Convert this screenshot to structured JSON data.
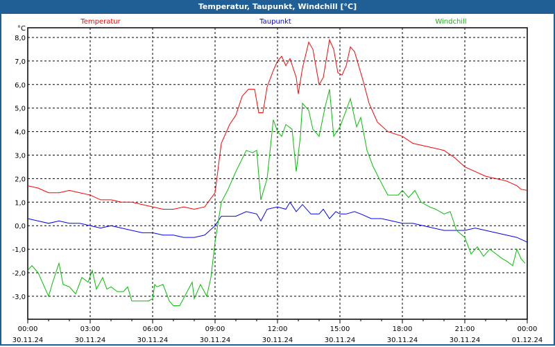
{
  "window": {
    "title": "Temperatur, Taupunkt, Windchill [°C]"
  },
  "chart_data": {
    "type": "line",
    "title": "Temperatur, Taupunkt, Windchill [°C]",
    "ylabel": "°C",
    "ylim": [
      -4.0,
      8.4
    ],
    "xlim": [
      0,
      24
    ],
    "grid": true,
    "legend_placement": "top",
    "yticks": [
      8,
      7,
      6,
      5,
      4,
      3,
      2,
      1,
      0,
      -1,
      -2,
      -3
    ],
    "ytick_labels": [
      "8,0",
      "7,0",
      "6,0",
      "5,0",
      "4,0",
      "3,0",
      "2,0",
      "1,0",
      "0,0",
      "-1,0",
      "-2,0",
      "-3,0"
    ],
    "xticks": [
      0,
      3,
      6,
      9,
      12,
      15,
      18,
      21,
      24
    ],
    "xtick_labels": [
      [
        "00:00",
        "30.11.24"
      ],
      [
        "03:00",
        "30.11.24"
      ],
      [
        "06:00",
        "30.11.24"
      ],
      [
        "09:00",
        "30.11.24"
      ],
      [
        "12:00",
        "30.11.24"
      ],
      [
        "15:00",
        "30.11.24"
      ],
      [
        "18:00",
        "30.11.24"
      ],
      [
        "21:00",
        "30.11.24"
      ],
      [
        "00:00",
        "01.12.24"
      ]
    ],
    "series": [
      {
        "name": "Temperatur",
        "color": "#ff0000",
        "legend": "left",
        "x": [
          0,
          0.5,
          1,
          1.5,
          2,
          2.5,
          3,
          3.5,
          4,
          4.5,
          5,
          5.5,
          6,
          6.5,
          7,
          7.5,
          8,
          8.5,
          9,
          9.3,
          9.7,
          10,
          10.3,
          10.6,
          10.9,
          11.1,
          11.3,
          11.5,
          11.8,
          12,
          12.2,
          12.4,
          12.6,
          12.9,
          13,
          13.2,
          13.5,
          13.7,
          14,
          14.2,
          14.5,
          14.7,
          14.9,
          15.1,
          15.3,
          15.5,
          15.7,
          15.9,
          16.1,
          16.4,
          16.8,
          17.3,
          18,
          18.5,
          19,
          19.5,
          20,
          20.5,
          21,
          21.5,
          22,
          22.5,
          23,
          23.5,
          23.7,
          24
        ],
        "y": [
          1.7,
          1.6,
          1.4,
          1.4,
          1.5,
          1.4,
          1.3,
          1.1,
          1.1,
          1.0,
          1.0,
          0.9,
          0.8,
          0.7,
          0.7,
          0.8,
          0.7,
          0.8,
          1.4,
          3.5,
          4.3,
          4.7,
          5.5,
          5.8,
          5.8,
          4.8,
          4.8,
          5.9,
          6.6,
          7.0,
          7.2,
          6.8,
          7.1,
          6.3,
          5.6,
          6.7,
          7.8,
          7.5,
          6.0,
          6.3,
          7.9,
          7.5,
          6.5,
          6.4,
          6.8,
          7.6,
          7.4,
          6.8,
          6.2,
          5.2,
          4.4,
          4.0,
          3.8,
          3.5,
          3.4,
          3.3,
          3.2,
          2.9,
          2.5,
          2.3,
          2.1,
          2.0,
          1.9,
          1.7,
          1.55,
          1.5
        ]
      },
      {
        "name": "Taupunkt",
        "color": "#0000ff",
        "legend": "center",
        "x": [
          0,
          0.5,
          1,
          1.5,
          2,
          2.5,
          3,
          3.5,
          4,
          4.5,
          5,
          5.5,
          6,
          6.5,
          7,
          7.5,
          8,
          8.5,
          9,
          9.3,
          9.7,
          10,
          10.5,
          11,
          11.2,
          11.5,
          12,
          12.4,
          12.6,
          12.9,
          13.2,
          13.6,
          14,
          14.2,
          14.5,
          14.8,
          15,
          15.3,
          15.7,
          16,
          16.5,
          17,
          17.5,
          18,
          18.5,
          19,
          19.5,
          20,
          20.5,
          21,
          21.5,
          22,
          22.5,
          23,
          23.5,
          24
        ],
        "y": [
          0.3,
          0.2,
          0.1,
          0.2,
          0.1,
          0.1,
          0.0,
          -0.1,
          0.0,
          -0.1,
          -0.2,
          -0.3,
          -0.3,
          -0.4,
          -0.4,
          -0.5,
          -0.5,
          -0.4,
          0.0,
          0.4,
          0.4,
          0.4,
          0.6,
          0.5,
          0.2,
          0.7,
          0.8,
          0.7,
          1.0,
          0.6,
          0.9,
          0.5,
          0.5,
          0.7,
          0.3,
          0.6,
          0.5,
          0.5,
          0.6,
          0.5,
          0.3,
          0.3,
          0.2,
          0.1,
          0.1,
          0.0,
          -0.1,
          -0.2,
          -0.2,
          -0.2,
          -0.1,
          -0.2,
          -0.3,
          -0.4,
          -0.5,
          -0.7
        ]
      },
      {
        "name": "Windchill",
        "color": "#00c000",
        "legend": "right",
        "x": [
          0,
          0.2,
          0.5,
          1,
          1.2,
          1.5,
          1.7,
          2,
          2.3,
          2.6,
          2.9,
          3.1,
          3.3,
          3.6,
          3.8,
          4,
          4.3,
          4.6,
          4.8,
          5,
          5.3,
          5.8,
          6,
          6.1,
          6.2,
          6.5,
          6.8,
          7,
          7.3,
          7.6,
          7.9,
          8,
          8.3,
          8.6,
          8.8,
          9,
          9.3,
          9.6,
          10,
          10.5,
          10.8,
          11,
          11.2,
          11.5,
          11.8,
          12,
          12.2,
          12.4,
          12.7,
          12.9,
          13.1,
          13.2,
          13.5,
          13.7,
          14,
          14.3,
          14.5,
          14.7,
          15,
          15.3,
          15.5,
          15.8,
          16,
          16.3,
          16.6,
          17,
          17.3,
          17.8,
          18,
          18.3,
          18.6,
          18.9,
          19.3,
          19.6,
          20,
          20.3,
          20.6,
          21,
          21.3,
          21.6,
          21.9,
          22.2,
          22.5,
          22.8,
          23,
          23.3,
          23.5,
          23.7,
          23.9
        ],
        "y": [
          -1.9,
          -1.7,
          -2.0,
          -3.0,
          -2.4,
          -1.6,
          -2.5,
          -2.6,
          -2.9,
          -2.2,
          -2.4,
          -1.9,
          -2.7,
          -2.2,
          -2.7,
          -2.6,
          -2.8,
          -2.8,
          -2.6,
          -3.2,
          -3.2,
          -3.2,
          -3.1,
          -2.5,
          -2.6,
          -2.5,
          -3.2,
          -3.4,
          -3.4,
          -2.9,
          -2.4,
          -3.1,
          -2.5,
          -3.0,
          -2.2,
          -0.7,
          1.0,
          1.5,
          2.3,
          3.2,
          3.1,
          3.2,
          1.1,
          2.0,
          4.5,
          4.0,
          3.8,
          4.3,
          4.1,
          2.3,
          3.8,
          5.2,
          4.9,
          4.1,
          3.8,
          5.1,
          5.8,
          3.8,
          4.2,
          4.9,
          5.4,
          4.2,
          4.6,
          3.2,
          2.5,
          1.8,
          1.3,
          1.3,
          1.5,
          1.2,
          1.5,
          1.0,
          0.8,
          0.7,
          0.5,
          0.6,
          -0.2,
          -0.5,
          -1.2,
          -0.9,
          -1.3,
          -1.0,
          -1.2,
          -1.4,
          -1.5,
          -1.7,
          -1.0,
          -1.4,
          -1.6
        ]
      }
    ]
  }
}
